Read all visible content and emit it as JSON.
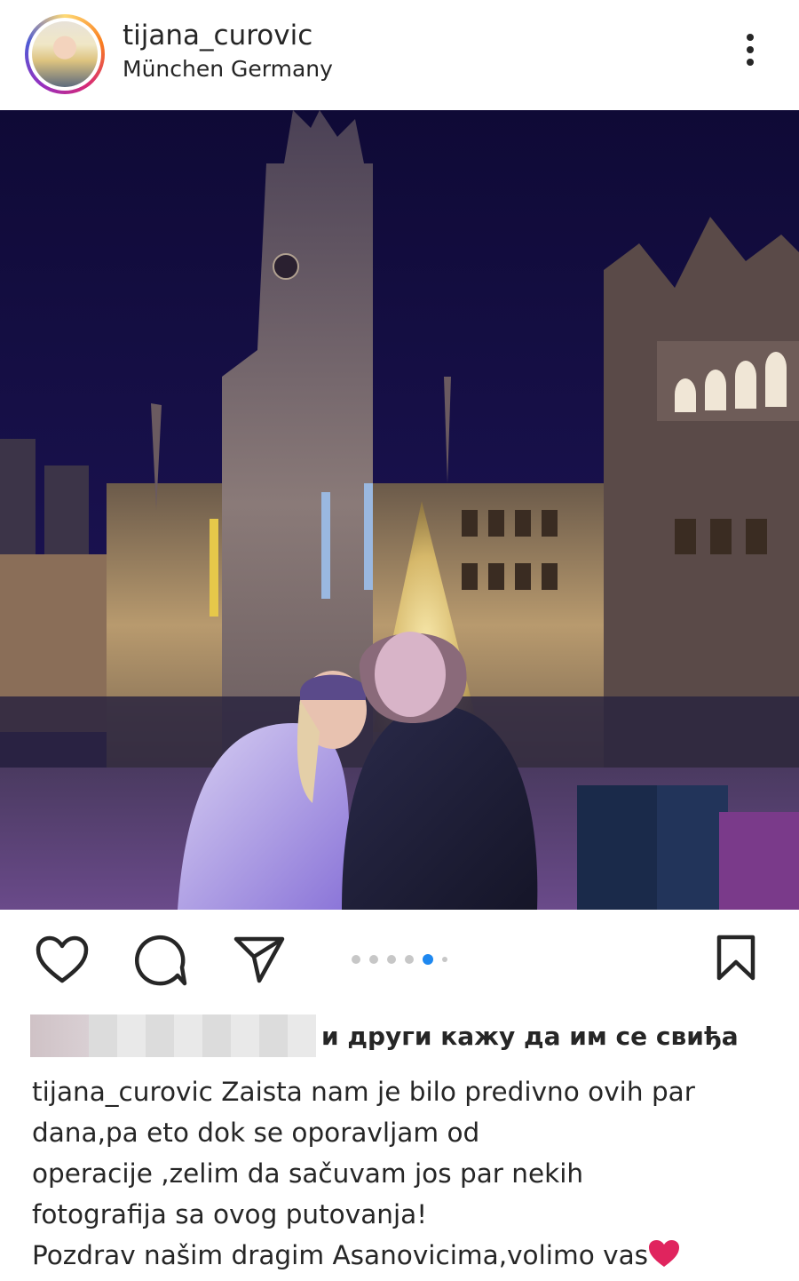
{
  "post": {
    "username": "tijana_curovic",
    "location": "München Germany"
  },
  "carousel": {
    "total_images": 6,
    "active_index": 5
  },
  "likes": {
    "text": "и други кажу да им се свиђа"
  },
  "caption": {
    "username": "tijana_curovic",
    "line1": "Zaista nam je bilo predivno ovih par",
    "line2": "dana,pa eto dok se oporavljam  od",
    "line3": "operacije ,zelim da sačuvam jos par nekih",
    "line4": "fotografija sa ovog putovanja!",
    "line5": "Pozdrav našim dragim Asanovicima,volimo vas"
  },
  "colors": {
    "text": "#262626",
    "active_dot": "#1e88f0",
    "inactive_dot": "#c7c7c7",
    "heart_emoji": "#e0245e"
  },
  "icons": [
    "more-vertical-icon",
    "heart-icon",
    "comment-icon",
    "share-icon",
    "bookmark-icon",
    "heart-emoji-icon"
  ]
}
